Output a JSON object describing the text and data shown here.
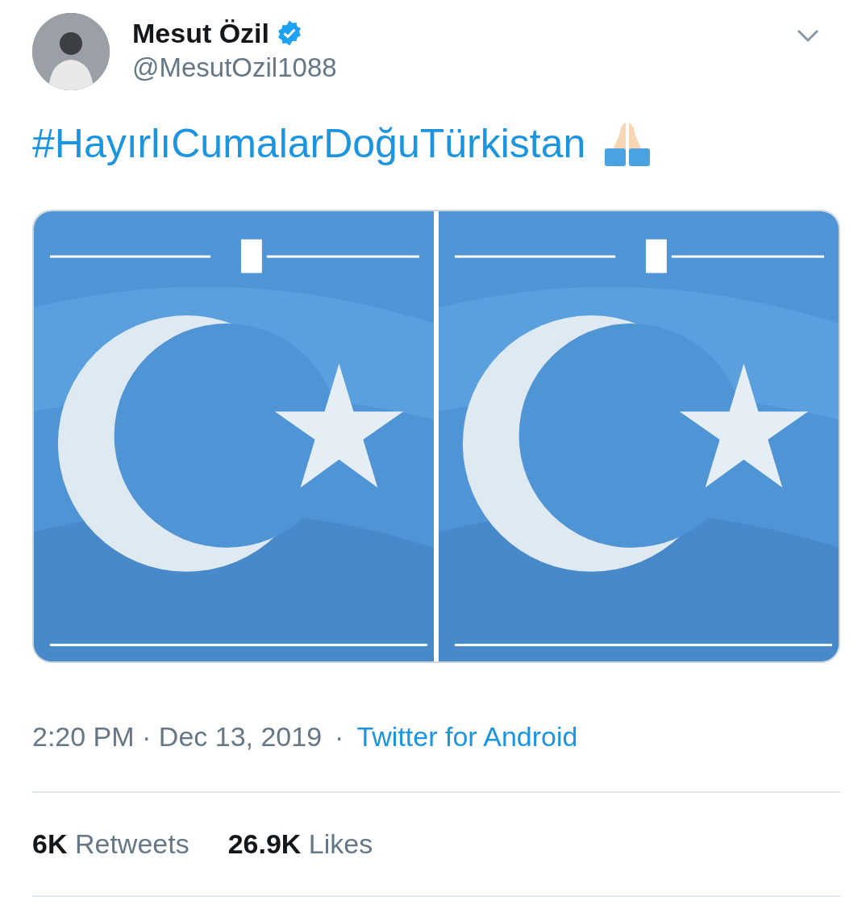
{
  "author": {
    "name": "Mesut Özil",
    "handle": "@MesutOzil1088",
    "verified": true
  },
  "text": "#HayırlıCumalarDoğuTürkistan",
  "meta": {
    "time": "2:20 PM · Dec 13, 2019",
    "separator": "·",
    "source": "Twitter for Android"
  },
  "stats": [
    {
      "count": "6K",
      "label": "Retweets"
    },
    {
      "count": "26.9K",
      "label": "Likes"
    }
  ]
}
